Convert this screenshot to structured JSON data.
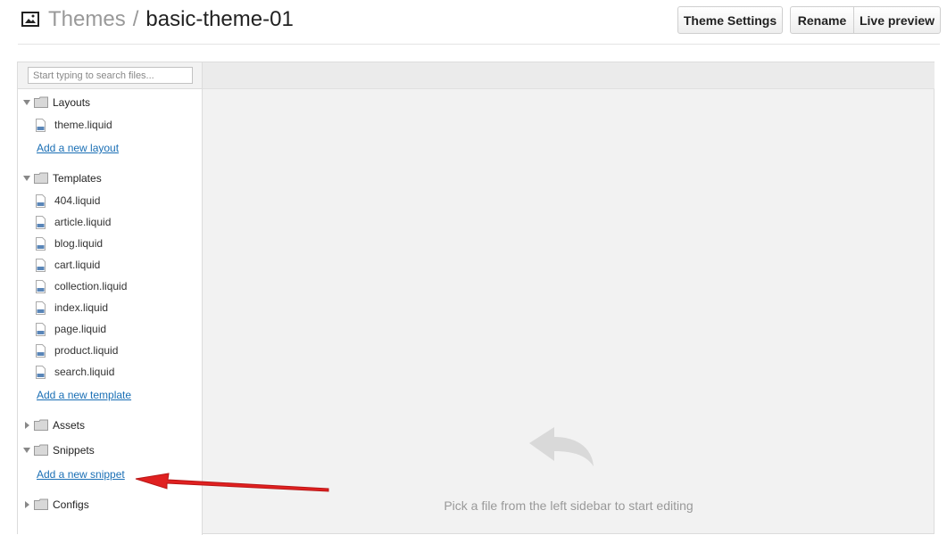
{
  "header": {
    "crumb": "Themes",
    "separator": "/",
    "current": "basic-theme-01",
    "theme_settings_label": "Theme Settings",
    "rename_label": "Rename",
    "live_preview_label": "Live preview"
  },
  "search": {
    "placeholder": "Start typing to search files..."
  },
  "sidebar": {
    "layouts": {
      "label": "Layouts",
      "files": [
        "theme.liquid"
      ],
      "add_label": "Add a new layout"
    },
    "templates": {
      "label": "Templates",
      "files": [
        "404.liquid",
        "article.liquid",
        "blog.liquid",
        "cart.liquid",
        "collection.liquid",
        "index.liquid",
        "page.liquid",
        "product.liquid",
        "search.liquid"
      ],
      "add_label": "Add a new template"
    },
    "assets": {
      "label": "Assets"
    },
    "snippets": {
      "label": "Snippets",
      "add_label": "Add a new snippet"
    },
    "configs": {
      "label": "Configs"
    }
  },
  "file_icon_label": "HTM",
  "empty_state": {
    "message": "Pick a file from the left sidebar to start editing"
  },
  "colors": {
    "link": "#1a6fb5",
    "annotation_arrow": "#e02020"
  }
}
